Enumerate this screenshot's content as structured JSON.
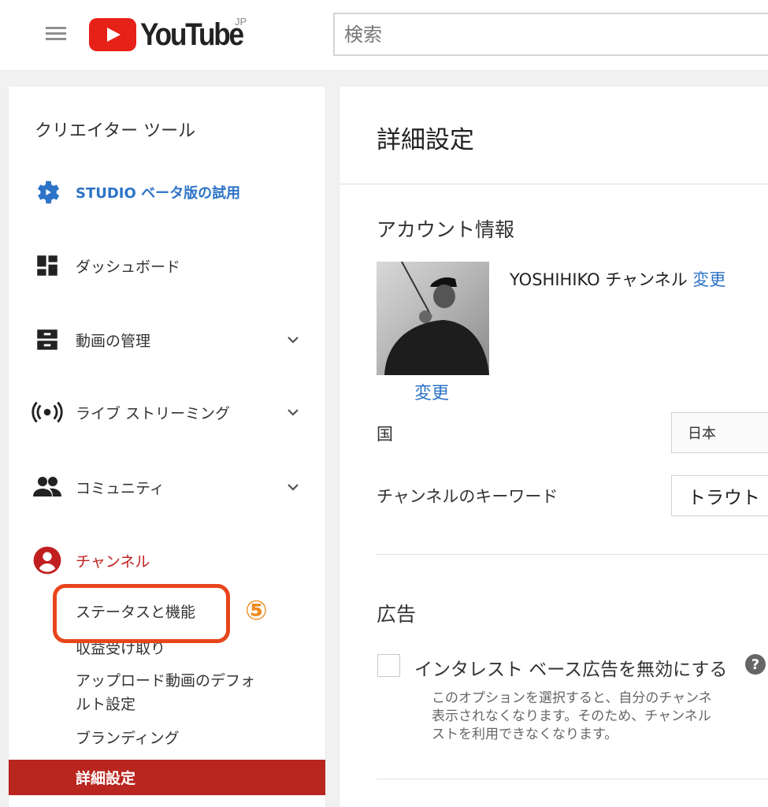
{
  "header": {
    "logo_text": "YouTube",
    "logo_region": "JP",
    "search_placeholder": "検索"
  },
  "sidebar": {
    "title": "クリエイター ツール",
    "items": [
      {
        "label": "STUDIO ベータ版の試用",
        "icon": "gear-play-icon"
      },
      {
        "label": "ダッシュボード",
        "icon": "dashboard-icon"
      },
      {
        "label": "動画の管理",
        "icon": "video-manager-icon"
      },
      {
        "label": "ライブ ストリーミング",
        "icon": "live-icon"
      },
      {
        "label": "コミュニティ",
        "icon": "people-icon"
      },
      {
        "label": "チャンネル",
        "icon": "account-circle-icon"
      }
    ],
    "sub_items": [
      "ステータスと機能",
      "収益受け取り",
      "アップロード動画のデフォ",
      "ルト設定",
      "ブランディング"
    ],
    "active_sub_item": "詳細設定",
    "annotation_number": "⑤"
  },
  "main": {
    "title": "詳細設定",
    "account": {
      "section_title": "アカウント情報",
      "channel_name": "YOSHIHIKO チャンネル",
      "change_link": "変更",
      "avatar_change_link": "変更",
      "country_label": "国",
      "country_value": "日本",
      "keywords_label": "チャンネルのキーワード",
      "keywords_value": "トラウト"
    },
    "ads": {
      "section_title": "広告",
      "checkbox_label": "インタレスト ベース広告を無効にする",
      "help_glyph": "?",
      "description": [
        "このオプションを選択すると、自分のチャンネ",
        "表示されなくなります。そのため、チャンネル",
        "ストを利用できなくなります。"
      ]
    }
  },
  "colors": {
    "brand_red": "#e62117",
    "link_blue": "#2d73c7",
    "active_bg": "#b9251f",
    "annotation": "#e8451c"
  }
}
